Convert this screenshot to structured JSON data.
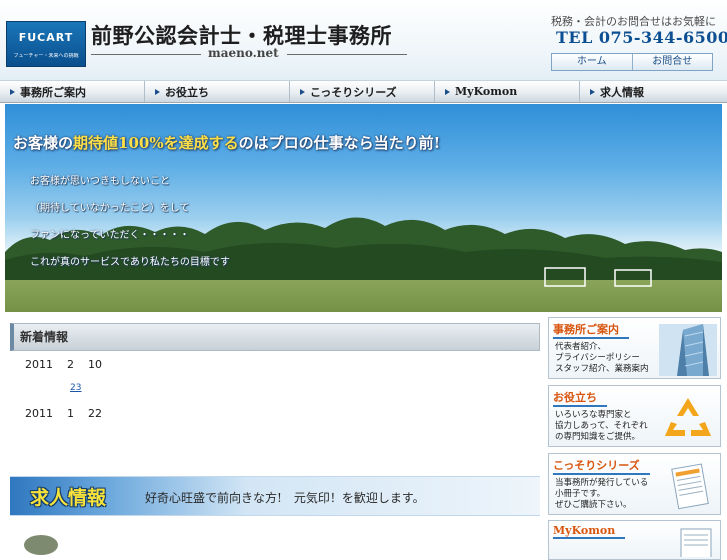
{
  "header": {
    "logo_mark": "FUCART",
    "logo_tagline": "フューチャー・未来への挑戦",
    "office_name": "前野公認会計士・税理士事務所",
    "domain": "maeno.net",
    "contact_lead": "税務・会計のお問合せはお気軽に",
    "tel": "TEL 075-344-6500",
    "buttons": {
      "home": "ホーム",
      "contact": "お問合せ"
    }
  },
  "nav": {
    "items": [
      {
        "label": "事務所ご案内"
      },
      {
        "label": "お役立ち"
      },
      {
        "label": "こっそりシリーズ"
      },
      {
        "label": "MyKomon"
      },
      {
        "label": "求人情報"
      }
    ]
  },
  "hero": {
    "headline_pre": "お客様の",
    "headline_highlight": "期待値100%を達成する",
    "headline_post": "のはプロの仕事なら当たり前!",
    "lines": [
      "お客様が思いつきもしないこと",
      "（期待していなかったこと）をして",
      "ファンになっていただく・・・・・",
      "これが真のサービスであり私たちの目標です"
    ]
  },
  "news": {
    "title": "新着情報",
    "entries": [
      {
        "year": "2011",
        "month": "2",
        "day": "10",
        "link": "23"
      },
      {
        "year": "2011",
        "month": "1",
        "day": "22"
      }
    ]
  },
  "recruit": {
    "title": "求人情報",
    "text": "好奇心旺盛で前向きな方!　元気印！を歓迎します。"
  },
  "side": [
    {
      "title": "事務所ご案内",
      "lines": [
        "代表者紹介、",
        "プライバシーポリシー",
        "スタッフ紹介、業務案内"
      ],
      "icon": "building-icon"
    },
    {
      "title": "お役立ち",
      "lines": [
        "いろいろな専門家と",
        "協力しあって、それぞれ",
        "の専門知識をご提供。"
      ],
      "icon": "recycle-icon"
    },
    {
      "title": "こっそりシリーズ",
      "lines": [
        "当事務所が発行している",
        "小冊子です。",
        "ぜひご購読下さい。"
      ],
      "icon": "booklet-icon"
    },
    {
      "title": "MyKomon",
      "lines": [],
      "icon": "document-icon"
    }
  ],
  "colors": {
    "accent_blue": "#0d4f93",
    "side_title_orange": "#d8550e",
    "headline_yellow": "#ffe046"
  }
}
